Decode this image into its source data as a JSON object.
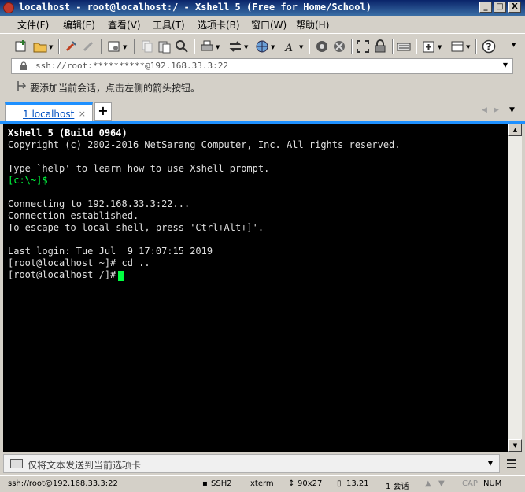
{
  "window": {
    "title": "localhost - root@localhost:/ - Xshell 5 (Free for Home/School)",
    "minimize": "_",
    "maximize": "□",
    "close": "X"
  },
  "menu": [
    "文件(F)",
    "编辑(E)",
    "查看(V)",
    "工具(T)",
    "选项卡(B)",
    "窗口(W)",
    "帮助(H)"
  ],
  "address": {
    "value": "ssh://root:**********@192.168.33.3:22",
    "dropdown_icon": "chevron-down-icon"
  },
  "hint": {
    "text": "要添加当前会话，点击左侧的箭头按钮。"
  },
  "tabs": [
    {
      "index": "1",
      "label": "localhost",
      "close": "×",
      "active": true
    }
  ],
  "tab_add": "+",
  "terminal": {
    "lines": [
      "Xshell 5 (Build 0964)",
      "Copyright (c) 2002-2016 NetSarang Computer, Inc. All rights reserved.",
      "",
      "Type `help' to learn how to use Xshell prompt.",
      "[c:\\~]$",
      "",
      "Connecting to 192.168.33.3:22...",
      "Connection established.",
      "To escape to local shell, press 'Ctrl+Alt+]'.",
      "",
      "Last login: Tue Jul  9 17:07:15 2019",
      "[root@localhost ~]# cd ..",
      "[root@localhost /]# "
    ],
    "colors": {
      "background": "#000000",
      "text": "#e0e0e0",
      "local_prompt": "#00ff40",
      "cursor": "#00ff40"
    }
  },
  "compose": {
    "text": "仅将文本发送到当前选项卡"
  },
  "status": {
    "connection": "ssh://root@192.168.33.3:22",
    "protocol": "SSH2",
    "terminal_type": "xterm",
    "size": "90x27",
    "cursor_pos": "13,21",
    "sessions": "1 会话",
    "caps": "CAP",
    "num": "NUM"
  },
  "colors": {
    "titlebar": "#0a246a",
    "accent": "#1e90ff",
    "chrome": "#d4d0c8"
  }
}
